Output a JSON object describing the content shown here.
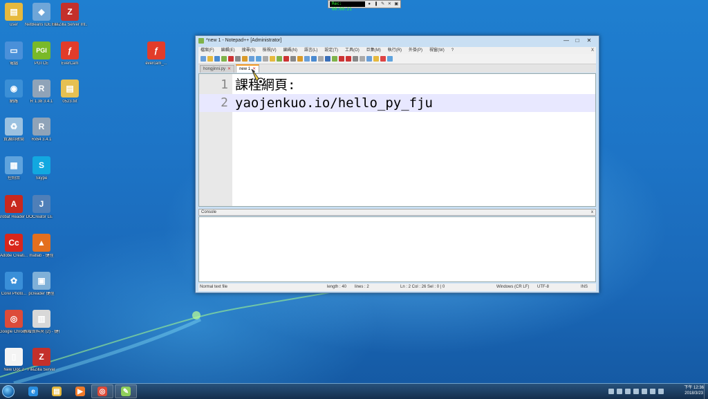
{
  "desktop_icons": [
    {
      "label": "user",
      "icon": "folder-icon",
      "color": "#e6b93e"
    },
    {
      "label": "NetBeans IDE 8.2",
      "icon": "netbeans-icon",
      "color": "#6fa6d8"
    },
    {
      "label": "FileZilla Server Int...",
      "icon": "filezilla-icon",
      "color": "#c4302b"
    },
    {
      "label": "電腦",
      "icon": "computer-icon",
      "color": "#4a90d9"
    },
    {
      "label": "PGI CE",
      "icon": "pgi-icon",
      "color": "#79b928"
    },
    {
      "label": "EverCam",
      "icon": "evercam-icon",
      "color": "#e23c2a"
    },
    {
      "label": "evercam_...",
      "icon": "evercam-icon",
      "color": "#e23c2a"
    },
    {
      "label": "網路",
      "icon": "network-icon",
      "color": "#3b8fd6"
    },
    {
      "label": "R 1.38 3.4.1",
      "icon": "r-icon",
      "color": "#8fa3b8"
    },
    {
      "label": "0523.txt",
      "icon": "folder-icon",
      "color": "#e6c052"
    },
    {
      "label": "資源回收筒",
      "icon": "recycle-bin-icon",
      "color": "#9bc1e0"
    },
    {
      "label": "Rx64 3.4.1",
      "icon": "r-icon",
      "color": "#8fa3b8"
    },
    {
      "label": "控制台",
      "icon": "control-panel-icon",
      "color": "#5fa3dd"
    },
    {
      "label": "Skype",
      "icon": "skype-icon",
      "color": "#12a8e0"
    },
    {
      "label": "Acrobat Reader DC",
      "icon": "acrobat-icon",
      "color": "#c8281e"
    },
    {
      "label": "JCreator LE",
      "icon": "jcreator-icon",
      "color": "#4f7fb8"
    },
    {
      "label": "Adobe Creati...",
      "icon": "creative-cloud-icon",
      "color": "#d9261c"
    },
    {
      "label": "matlab - 捷徑",
      "icon": "matlab-icon",
      "color": "#e36f1e"
    },
    {
      "label": "Corel Photo...",
      "icon": "corel-icon",
      "color": "#3a8fd8"
    },
    {
      "label": "pcreader 捷徑",
      "icon": "reader-icon",
      "color": "#7fb0d8"
    },
    {
      "label": "Google Chrome",
      "icon": "chrome-icon",
      "color": "#dd4b39"
    },
    {
      "label": "新增資料夾 (2) - 捷徑",
      "icon": "notepad-icon",
      "color": "#d8d8d8"
    },
    {
      "label": "New Doc 2",
      "icon": "document-icon",
      "color": "#f4f4f4"
    },
    {
      "label": "FileZilla Server",
      "icon": "filezilla-icon",
      "color": "#c4302b"
    }
  ],
  "recorder": {
    "time": "Rec: 00:00:21"
  },
  "window": {
    "title": "*new 1 - Notepad++ [Administrator]",
    "buttons": {
      "minimize": "—",
      "maximize": "□",
      "close": "✕"
    },
    "menu": [
      "檔案(F)",
      "編輯(E)",
      "搜尋(S)",
      "檢視(V)",
      "編碼(N)",
      "語言(L)",
      "設定(T)",
      "工具(O)",
      "巨集(M)",
      "執行(R)",
      "外掛(P)",
      "視窗(W)",
      "?"
    ],
    "menu_close": "X",
    "tabs": [
      {
        "label": "hongjinni.py",
        "close": "✕",
        "active": false
      },
      {
        "label": "new 1",
        "close": "✕",
        "active": true
      }
    ],
    "editor": {
      "lines": [
        {
          "number": "1",
          "text": "課程網頁:"
        },
        {
          "number": "2",
          "text": "yaojenkuo.io/hello_py_fju"
        }
      ]
    },
    "console": {
      "title": "Console",
      "close": "x"
    },
    "status": {
      "type": "Normal text file",
      "length": "length : 40",
      "lines": "lines : 2",
      "position": "Ln : 2    Col : 26    Sel : 0 | 0",
      "eol": "Windows (CR LF)",
      "encoding": "UTF-8",
      "mode": "INS"
    }
  },
  "taskbar": {
    "items": [
      {
        "icon": "internet-explorer-icon",
        "color": "#2a8ee0",
        "open": false
      },
      {
        "icon": "file-explorer-icon",
        "color": "#e6b93e",
        "open": false
      },
      {
        "icon": "media-player-icon",
        "color": "#f07a2a",
        "open": false
      },
      {
        "icon": "chrome-icon",
        "color": "#dd4b39",
        "open": true
      },
      {
        "icon": "notepadpp-icon",
        "color": "#8fcf5a",
        "open": true
      }
    ],
    "clock_time": "下午 12:36",
    "clock_date": "2018/3/23"
  }
}
